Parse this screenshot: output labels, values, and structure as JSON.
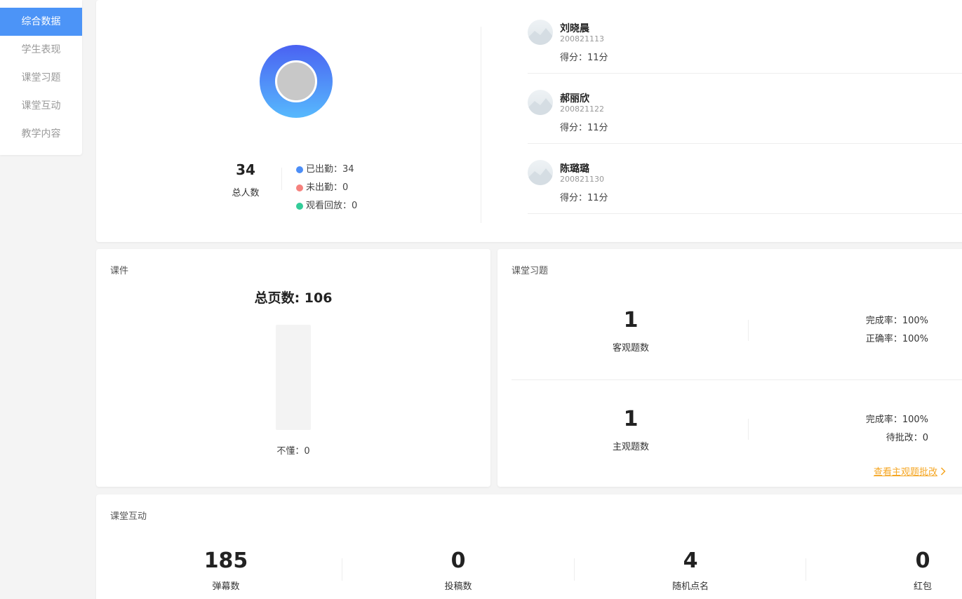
{
  "sidebar": {
    "items": [
      {
        "label": "综合数据",
        "active": true
      },
      {
        "label": "学生表现"
      },
      {
        "label": "课堂习题"
      },
      {
        "label": "课堂互动"
      },
      {
        "label": "教学内容"
      }
    ]
  },
  "attendance": {
    "total": "34",
    "total_label": "总人数",
    "legend": [
      {
        "label": "已出勤：34",
        "color": "#4c8ef7"
      },
      {
        "label": "未出勤：0",
        "color": "#f5817d"
      },
      {
        "label": "观看回放：0",
        "color": "#33cc99"
      }
    ]
  },
  "students": [
    {
      "name": "刘晓晨",
      "id": "200821113",
      "score": "得分：11分"
    },
    {
      "name": "郝丽欣",
      "id": "200821122",
      "score": "得分：11分"
    },
    {
      "name": "陈璐璐",
      "id": "200821130",
      "score": "得分：11分"
    }
  ],
  "courseware": {
    "title": "课件",
    "total_pages": "总页数: 106",
    "confused": "不懂：0",
    "confused_value": 0
  },
  "exercises": {
    "title": "课堂习题",
    "objective": {
      "count": "1",
      "label": "客观题数",
      "stats": [
        "完成率：100%",
        "正确率：100%"
      ]
    },
    "subjective": {
      "count": "1",
      "label": "主观题数",
      "stats": [
        "完成率：100%",
        "待批改：0"
      ]
    },
    "link": "查看主观题批改"
  },
  "interaction": {
    "title": "课堂互动",
    "items": [
      {
        "value": "185",
        "label": "弹幕数"
      },
      {
        "value": "0",
        "label": "投稿数"
      },
      {
        "value": "4",
        "label": "随机点名"
      },
      {
        "value": "0",
        "label": "红包"
      }
    ]
  }
}
